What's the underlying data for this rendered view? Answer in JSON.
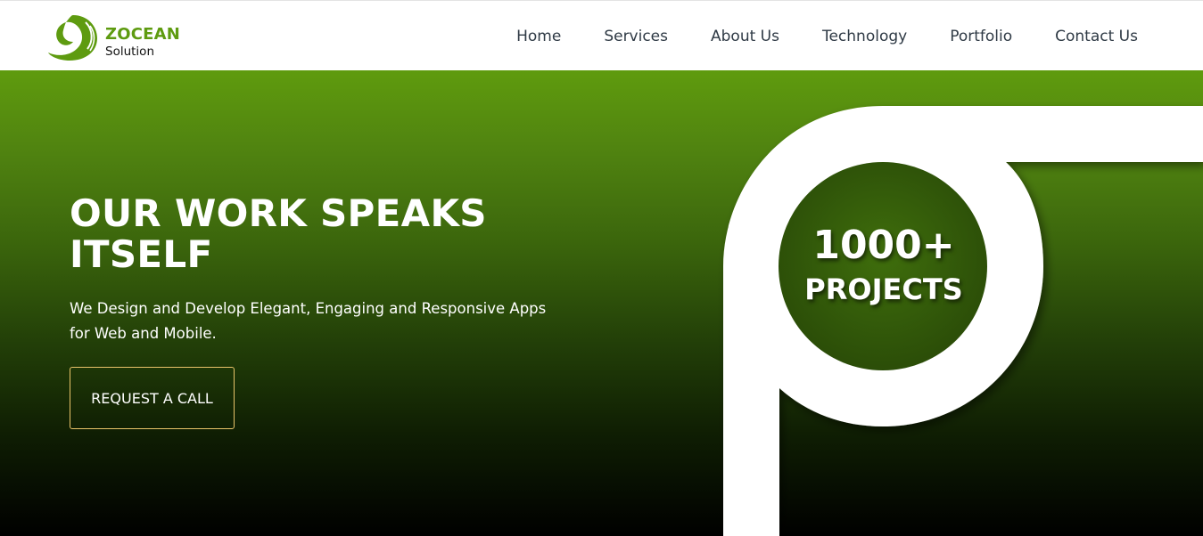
{
  "brand": {
    "name": "ZOCEAN",
    "sub": "Solution",
    "color": "#5e9b10"
  },
  "nav": {
    "items": [
      {
        "label": "Home"
      },
      {
        "label": "Services"
      },
      {
        "label": "About Us"
      },
      {
        "label": "Technology"
      },
      {
        "label": "Portfolio"
      },
      {
        "label": "Contact Us"
      }
    ]
  },
  "hero": {
    "title": "OUR WORK SPEAKS ITSELF",
    "subtitle": "We Design and Develop Elegant, Engaging and Responsive Apps for Web and Mobile.",
    "cta_label": "REQUEST A CALL",
    "gradient_top": "#5f9b0e",
    "gradient_bottom": "#000000",
    "cta_border_color": "#e9c46a"
  },
  "stat": {
    "count": "1000+",
    "label": "PROJECTS"
  }
}
